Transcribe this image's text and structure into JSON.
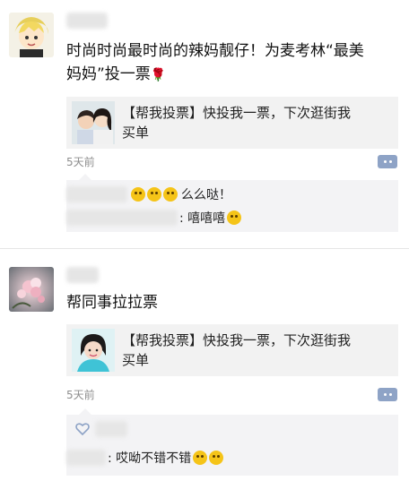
{
  "posts": [
    {
      "text_line1": "时尚时尚最时尚的辣妈靓仔！为麦考林“最美",
      "text_line2": "妈妈”投一票",
      "text_emoji": "🌹",
      "share_title_line1": "【帮我投票】快投我一票，下次逛街我",
      "share_title_line2": "买单",
      "time": "5天前",
      "comments": [
        {
          "text": "么么哒！",
          "emojis": 3
        },
        {
          "text": ": 嘻嘻嘻",
          "emojis": 1
        }
      ]
    },
    {
      "text_line1": "帮同事拉拉票",
      "share_title_line1": "【帮我投票】快投我一票，下次逛街我",
      "share_title_line2": "买单",
      "time": "5天前",
      "comments": [
        {
          "text": ": 哎呦不错不错",
          "emojis": 2
        }
      ]
    }
  ],
  "colors": {
    "link_blue": "#8ea3c6",
    "comment_bg": "#f3f3f5",
    "share_bg": "#f2f2f2",
    "time_gray": "#8e8e8e"
  },
  "icons": [
    "comment-dots-icon",
    "heart-like-icon",
    "rose-emoji-icon",
    "smile-emoji-icon"
  ]
}
